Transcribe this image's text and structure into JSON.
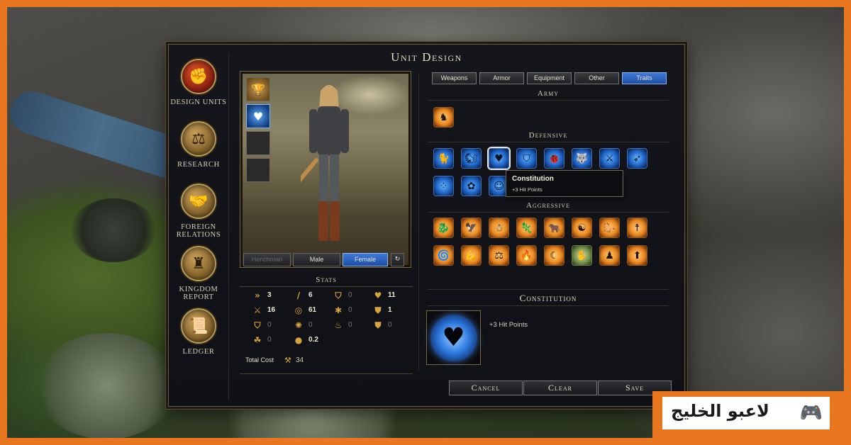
{
  "window": {
    "title": "Unit Design"
  },
  "nav": [
    {
      "label": "Design Units",
      "icon": "fist-icon",
      "glyph": "✊",
      "active": true
    },
    {
      "label": "Research",
      "icon": "compass-icon",
      "glyph": "⚖"
    },
    {
      "label": "Foreign Relations",
      "icon": "handshake-icon",
      "glyph": "🤝"
    },
    {
      "label": "Kingdom Report",
      "icon": "castle-icon",
      "glyph": "♜"
    },
    {
      "label": "Ledger",
      "icon": "scroll-icon",
      "glyph": "📜"
    }
  ],
  "equipment_slots": [
    {
      "icon": "goblet-icon",
      "glyph": "🏆",
      "kind": "item"
    },
    {
      "icon": "heart-icon",
      "glyph": "♥",
      "kind": "trait"
    },
    {
      "icon": "empty-slot",
      "glyph": "",
      "kind": "empty"
    },
    {
      "icon": "empty-slot",
      "glyph": "",
      "kind": "empty"
    }
  ],
  "gender": {
    "henchman": "Henchman",
    "male": "Male",
    "female": "Female",
    "selected": "Female",
    "rotate_icon": "rotate-icon"
  },
  "stats": {
    "title": "Stats",
    "items": [
      {
        "icon": "speed-icon",
        "glyph": "»",
        "value": "3"
      },
      {
        "icon": "sword-icon",
        "glyph": "/",
        "value": "6"
      },
      {
        "icon": "shield-icon",
        "glyph": "⛉",
        "value": "0"
      },
      {
        "icon": "heart-icon",
        "glyph": "♥",
        "value": "11"
      },
      {
        "icon": "crossed-swords-icon",
        "glyph": "⚔",
        "value": "16"
      },
      {
        "icon": "target-icon",
        "glyph": "◎",
        "value": "61"
      },
      {
        "icon": "hit-icon",
        "glyph": "✱",
        "value": "0"
      },
      {
        "icon": "armor-icon",
        "glyph": "⛊",
        "value": "1"
      },
      {
        "icon": "shield-plus-icon",
        "glyph": "⛉",
        "value": "0"
      },
      {
        "icon": "spell-icon",
        "glyph": "✺",
        "value": "0"
      },
      {
        "icon": "fire-shield-icon",
        "glyph": "♨",
        "value": "0"
      },
      {
        "icon": "dodge-icon",
        "glyph": "⛊",
        "value": "0"
      },
      {
        "icon": "magic-icon",
        "glyph": "☘",
        "value": "0"
      },
      {
        "icon": "gold-icon",
        "glyph": "●",
        "value": "0.2"
      }
    ],
    "total_label": "Total Cost",
    "total_icon": "production-icon",
    "total_value": "34"
  },
  "tabs": [
    {
      "label": "Weapons"
    },
    {
      "label": "Armor"
    },
    {
      "label": "Equipment"
    },
    {
      "label": "Other"
    },
    {
      "label": "Traits",
      "active": true
    }
  ],
  "sections": {
    "army": "Army",
    "defensive": "Defensive",
    "aggressive": "Aggressive"
  },
  "army_traits": [
    {
      "icon": "army-trait-icon",
      "glyph": "♞",
      "color": "orange"
    }
  ],
  "defensive_traits": [
    {
      "icon": "cat-icon",
      "glyph": "🐈"
    },
    {
      "icon": "squirrel-icon",
      "glyph": "🐿"
    },
    {
      "icon": "heart-icon",
      "glyph": "♥",
      "selected": true
    },
    {
      "icon": "shield-icon",
      "glyph": "⛉"
    },
    {
      "icon": "beetle-icon",
      "glyph": "🐞"
    },
    {
      "icon": "wolf-icon",
      "glyph": "🐺"
    },
    {
      "icon": "fencer-icon",
      "glyph": "⚔"
    },
    {
      "icon": "archer-icon",
      "glyph": "➶"
    },
    {
      "icon": "footprints-icon",
      "glyph": "⁘"
    },
    {
      "icon": "flower-icon",
      "glyph": "✿"
    },
    {
      "icon": "mask-icon",
      "glyph": "☺"
    }
  ],
  "aggressive_traits": [
    {
      "icon": "dragon-icon",
      "glyph": "🐉"
    },
    {
      "icon": "eagle-icon",
      "glyph": "🦅"
    },
    {
      "icon": "ogre-icon",
      "glyph": "☃"
    },
    {
      "icon": "lizard-icon",
      "glyph": "🦎"
    },
    {
      "icon": "bull-icon",
      "glyph": "🐂"
    },
    {
      "icon": "twin-faces-icon",
      "glyph": "☯"
    },
    {
      "icon": "horse-icon",
      "glyph": "🐎"
    },
    {
      "icon": "spearman-icon",
      "glyph": "☨"
    },
    {
      "icon": "vortex-icon",
      "glyph": "🌀"
    },
    {
      "icon": "flex-arm-icon",
      "glyph": "💪"
    },
    {
      "icon": "compass-icon",
      "glyph": "⚖"
    },
    {
      "icon": "flame-icon",
      "glyph": "🔥"
    },
    {
      "icon": "crescent-icon",
      "glyph": "☾"
    },
    {
      "icon": "hand-icon",
      "glyph": "✋",
      "color": "green"
    },
    {
      "icon": "brute-icon",
      "glyph": "♟"
    },
    {
      "icon": "arrow-up-icon",
      "glyph": "⬆"
    }
  ],
  "tooltip": {
    "title": "Constitution",
    "desc": "+3 Hit Points"
  },
  "detail": {
    "title": "Constitution",
    "desc": "+3 Hit Points",
    "icon": "heart-icon",
    "glyph": "♥"
  },
  "actions": {
    "cancel": "Cancel",
    "clear": "Clear",
    "save": "Save"
  },
  "watermark": {
    "text": "لاعبو الخليج",
    "icon": "gamepad-icon",
    "glyph": "🎮"
  },
  "colors": {
    "accent_blue": "#2f6fd0",
    "frame_gold": "#7a6642",
    "site_orange": "#e8771f"
  }
}
